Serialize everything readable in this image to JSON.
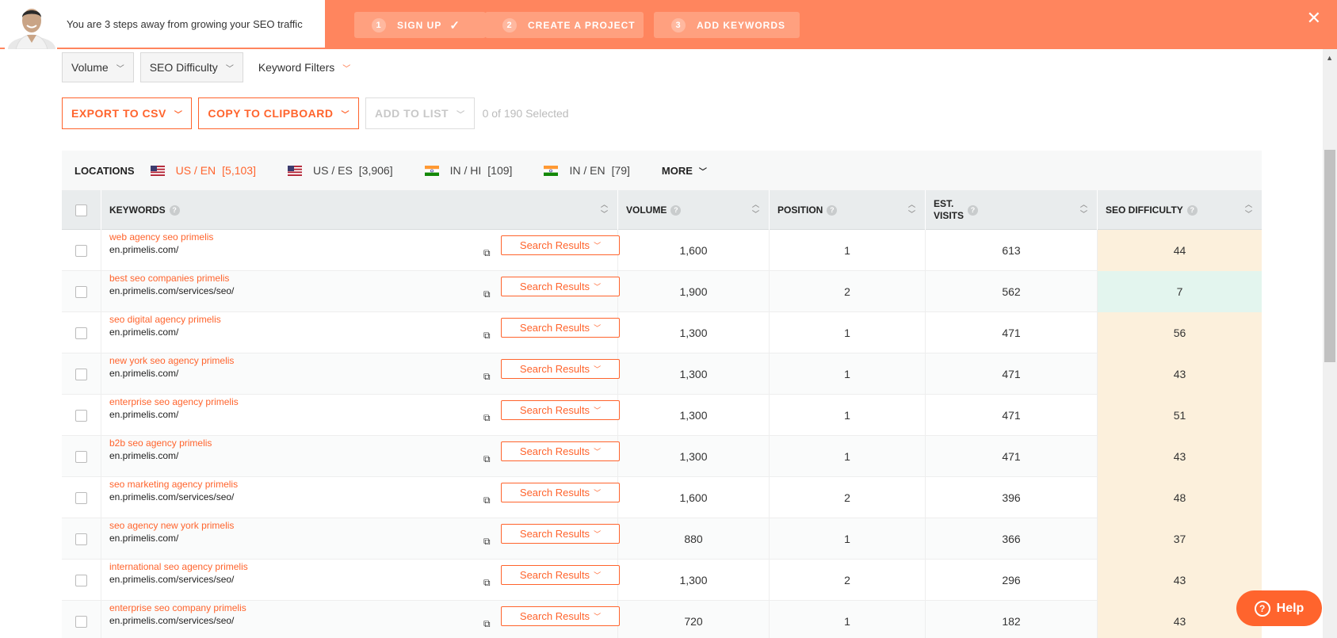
{
  "banner": {
    "text": "You are 3 steps away from growing your SEO traffic",
    "steps": [
      {
        "num": "1",
        "label": "SIGN UP",
        "done": true
      },
      {
        "num": "2",
        "label": "CREATE A PROJECT",
        "done": false
      },
      {
        "num": "3",
        "label": "ADD KEYWORDS",
        "done": false
      }
    ],
    "close_icon": "close-icon"
  },
  "filters": [
    {
      "label": "Volume"
    },
    {
      "label": "SEO Difficulty"
    },
    {
      "label": "Keyword Filters"
    }
  ],
  "actions": {
    "export": "EXPORT TO CSV",
    "copy": "COPY TO CLIPBOARD",
    "add_to_list": "ADD TO LIST",
    "selected": "0 of 190 Selected"
  },
  "locations": {
    "title": "LOCATIONS",
    "items": [
      {
        "label": "US / EN",
        "count": "[5,103]",
        "flag": "us",
        "active": true
      },
      {
        "label": "US / ES",
        "count": "[3,906]",
        "flag": "us",
        "active": false
      },
      {
        "label": "IN / HI",
        "count": "[109]",
        "flag": "in",
        "active": false
      },
      {
        "label": "IN / EN",
        "count": "[79]",
        "flag": "in",
        "active": false
      }
    ],
    "more": "MORE"
  },
  "table": {
    "headers": {
      "keywords": "KEYWORDS",
      "volume": "VOLUME",
      "position": "POSITION",
      "est_visits_1": "EST.",
      "est_visits_2": "VISITS",
      "seo_difficulty": "SEO DIFFICULTY"
    },
    "search_results_label": "Search Results",
    "rows": [
      {
        "keyword": "web agency seo primelis",
        "url": "en.primelis.com/",
        "volume": "1,600",
        "position": "1",
        "visits": "613",
        "difficulty": "44"
      },
      {
        "keyword": "best seo companies primelis",
        "url": "en.primelis.com/services/seo/",
        "volume": "1,900",
        "position": "2",
        "visits": "562",
        "difficulty": "7"
      },
      {
        "keyword": "seo digital agency primelis",
        "url": "en.primelis.com/",
        "volume": "1,300",
        "position": "1",
        "visits": "471",
        "difficulty": "56"
      },
      {
        "keyword": "new york seo agency primelis",
        "url": "en.primelis.com/",
        "volume": "1,300",
        "position": "1",
        "visits": "471",
        "difficulty": "43"
      },
      {
        "keyword": "enterprise seo agency primelis",
        "url": "en.primelis.com/",
        "volume": "1,300",
        "position": "1",
        "visits": "471",
        "difficulty": "51"
      },
      {
        "keyword": "b2b seo agency primelis",
        "url": "en.primelis.com/",
        "volume": "1,300",
        "position": "1",
        "visits": "471",
        "difficulty": "43"
      },
      {
        "keyword": "seo marketing agency primelis",
        "url": "en.primelis.com/services/seo/",
        "volume": "1,600",
        "position": "2",
        "visits": "396",
        "difficulty": "48"
      },
      {
        "keyword": "seo agency new york primelis",
        "url": "en.primelis.com/",
        "volume": "880",
        "position": "1",
        "visits": "366",
        "difficulty": "37"
      },
      {
        "keyword": "international seo agency primelis",
        "url": "en.primelis.com/services/seo/",
        "volume": "1,300",
        "position": "2",
        "visits": "296",
        "difficulty": "43"
      },
      {
        "keyword": "enterprise seo company primelis",
        "url": "en.primelis.com/services/seo/",
        "volume": "720",
        "position": "1",
        "visits": "182",
        "difficulty": "43"
      }
    ]
  },
  "help": {
    "label": "Help"
  },
  "colors": {
    "accent": "#ff642d",
    "banner": "#ff855e",
    "diff_medium": "#fcf0dc",
    "diff_low": "#e3f5ee"
  }
}
